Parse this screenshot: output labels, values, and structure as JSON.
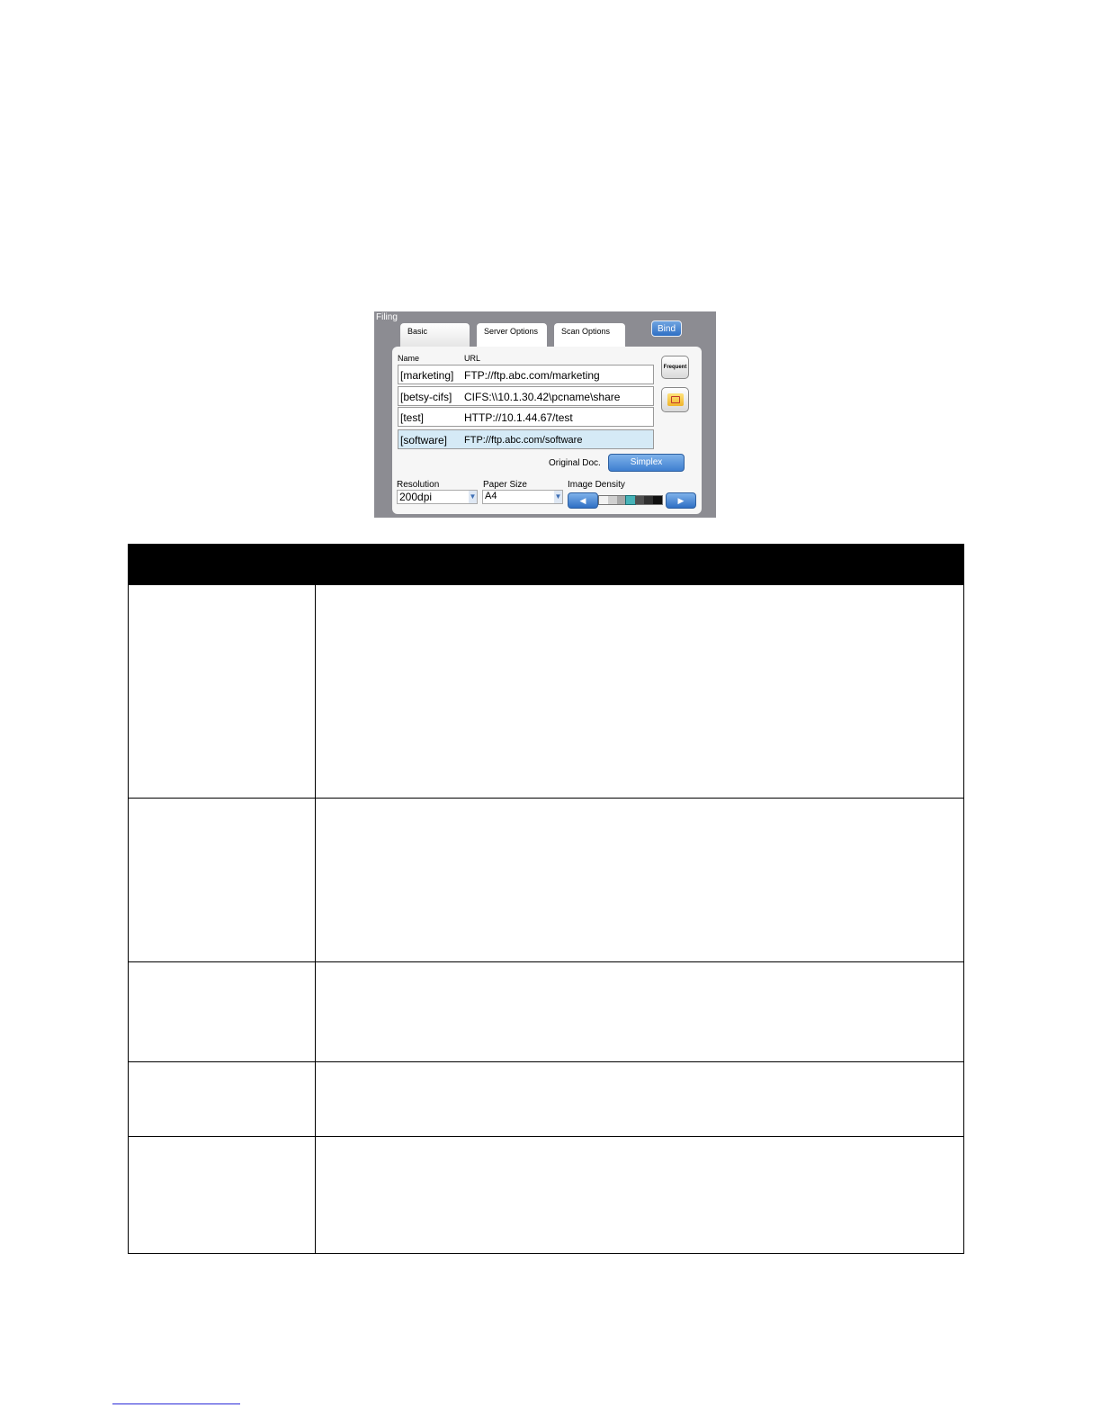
{
  "panel": {
    "title": "Filing",
    "tabs": [
      "Basic",
      "Server Options",
      "Scan Options"
    ],
    "bind_label": "Bind",
    "headers": {
      "name": "Name",
      "url": "URL"
    },
    "destinations": [
      {
        "name": "[marketing]",
        "url": "FTP://ftp.abc.com/marketing",
        "selected": false
      },
      {
        "name": "[betsy-cifs]",
        "url": "CIFS:\\\\10.1.30.42\\pcname\\share",
        "selected": false
      },
      {
        "name": "[test]",
        "url": "HTTP://10.1.44.67/test",
        "selected": false
      },
      {
        "name": "[software]",
        "url": "FTP://ftp.abc.com/software",
        "selected": true
      }
    ],
    "frequent_label": "Frequent",
    "original_doc_label": "Original Doc.",
    "original_doc_value": "Simplex",
    "resolution_label": "Resolution",
    "resolution_value": "200dpi",
    "paper_size_label": "Paper Size",
    "paper_size_value": "A4",
    "image_density_label": "Image Density",
    "density_levels": [
      "#f2f2f2",
      "#d0d0d0",
      "#a8a8a8",
      "#46b3b8",
      "#505050",
      "#303030",
      "#101010"
    ],
    "density_selected_index": 3,
    "accent_color": "#3e7fd0"
  }
}
